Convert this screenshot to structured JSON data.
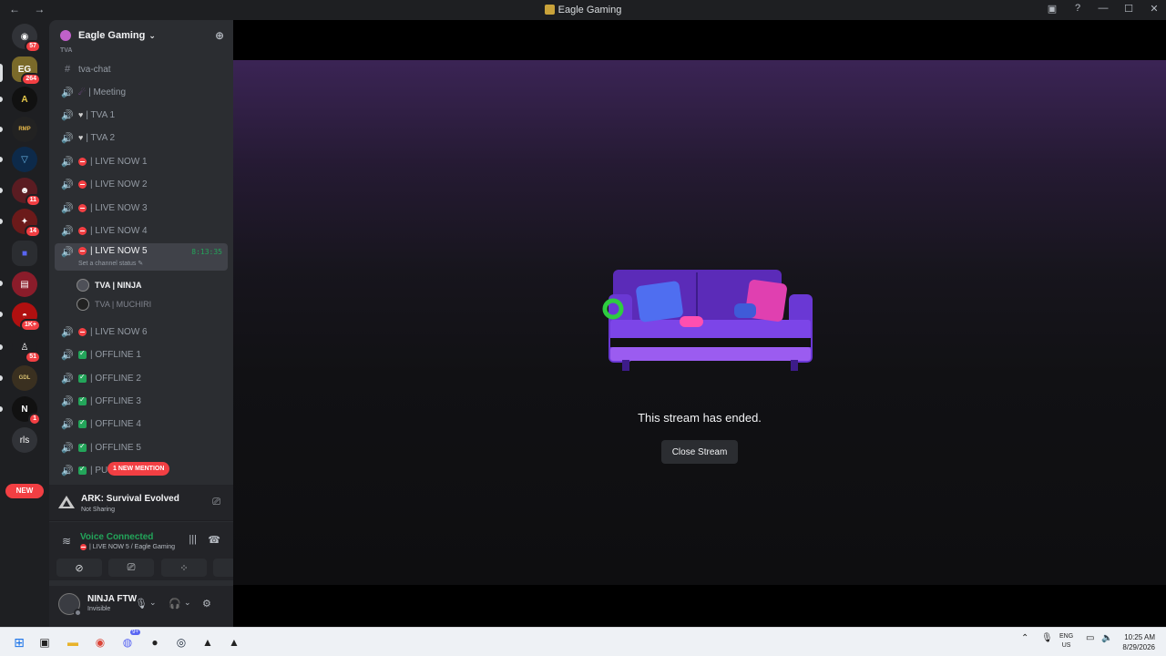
{
  "window": {
    "title": "Eagle Gaming",
    "nav": "← →"
  },
  "guild_bar": {
    "badges": [
      "57",
      "264",
      "11",
      "14",
      "1K+",
      "51",
      "1"
    ],
    "rls_label": "rls",
    "new_label": "NEW"
  },
  "server": {
    "name": "Eagle Gaming",
    "category": "TVA"
  },
  "channels": [
    {
      "name": "tva-chat"
    },
    {
      "name": "| Meeting"
    },
    {
      "name": "| TVA 1"
    },
    {
      "name": "| TVA 2"
    },
    {
      "name": "| LIVE NOW 1"
    },
    {
      "name": "| LIVE NOW 2"
    },
    {
      "name": "| LIVE NOW 3"
    },
    {
      "name": "| LIVE NOW 4"
    },
    {
      "name": "| LIVE NOW 5",
      "timer": "8:13:35",
      "status": "Set a channel status"
    },
    {
      "name": "| LIVE NOW 6"
    },
    {
      "name": "| OFFLINE 1"
    },
    {
      "name": "| OFFLINE 2"
    },
    {
      "name": "| OFFLINE 3"
    },
    {
      "name": "| OFFLINE 4"
    },
    {
      "name": "| OFFLINE 5"
    },
    {
      "name": "| PU"
    }
  ],
  "voice_users": [
    "TVA | NINJA",
    "TVA | MUCHIRI"
  ],
  "mention_label": "1 NEW MENTION",
  "activity": {
    "game": "ARK: Survival Evolved",
    "sub": "Not Sharing"
  },
  "voice": {
    "title": "Voice Connected",
    "sub": "| LIVE NOW 5 / Eagle Gaming"
  },
  "user": {
    "name": "NINJA FTW",
    "status": "Invisible"
  },
  "stream": {
    "message": "This stream has ended.",
    "close_label": "Close Stream"
  },
  "taskbar": {
    "lang": "ENG",
    "region": "US",
    "time": "10:25 AM",
    "date": "8/29/2026",
    "badge": "9+"
  },
  "colors": {
    "accent_green": "#23a55a",
    "danger": "#f23f43",
    "bg": "#1e1f22",
    "sidebar": "#2b2d31"
  }
}
